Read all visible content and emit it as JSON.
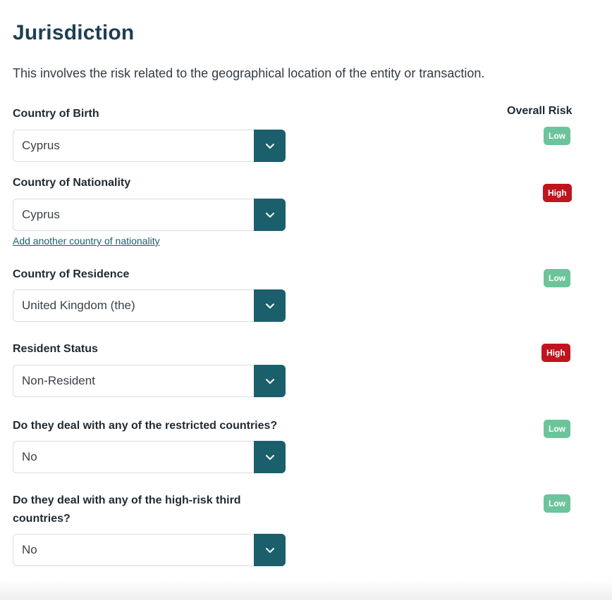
{
  "header": {
    "title": "Jurisdiction",
    "description": "This involves the risk related to the geographical location of the entity or transaction.",
    "overall_risk_label": "Overall Risk"
  },
  "fields": [
    {
      "label": "Country of Birth",
      "value": "Cyprus",
      "risk": "Low"
    },
    {
      "label": "Country of Nationality",
      "value": "Cyprus",
      "risk": "High",
      "link": "Add another country of nationality"
    },
    {
      "label": "Country of Residence",
      "value": "United Kingdom (the)",
      "risk": "Low"
    },
    {
      "label": "Resident Status",
      "value": "Non-Resident",
      "risk": "High"
    },
    {
      "label": "Do they deal with any of the restricted countries?",
      "value": "No",
      "risk": "Low"
    },
    {
      "label": "Do they deal with any of the high-risk third countries?",
      "value": "No",
      "risk": "Low"
    }
  ],
  "icons": {
    "dropdown": "chevron-down-icon"
  },
  "colors": {
    "accent": "#1b5f6c",
    "low": "#6cc49a",
    "high": "#c0141e",
    "title": "#1f3f52"
  }
}
